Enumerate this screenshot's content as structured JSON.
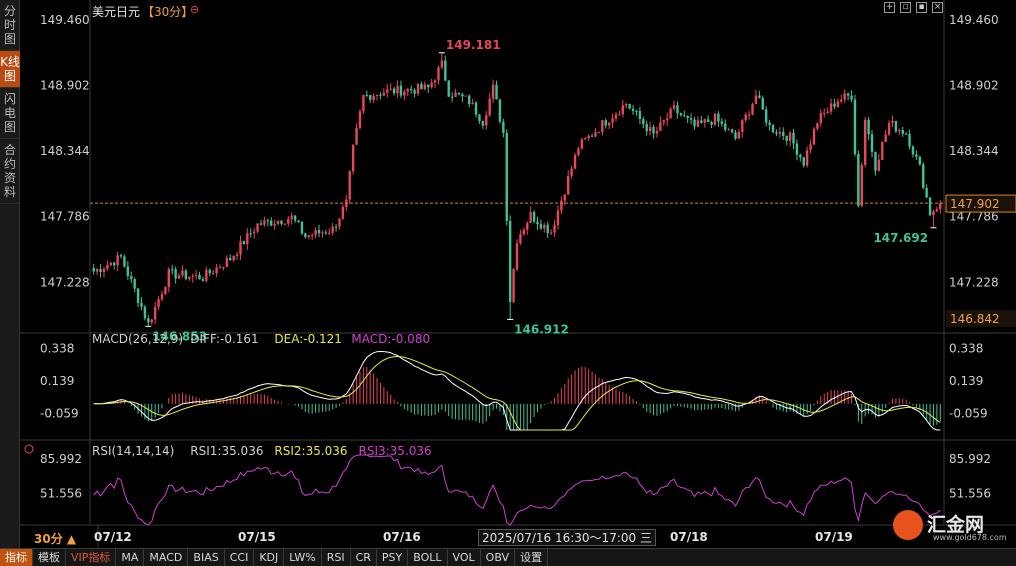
{
  "left_tabs": [
    {
      "label": "分时图",
      "active": false
    },
    {
      "label": "K线图",
      "active": true
    },
    {
      "label": "闪电图",
      "active": false
    },
    {
      "label": "合约资料",
      "active": false
    }
  ],
  "header": {
    "symbol": "美元日元",
    "period": "【30分】",
    "toolbar_icons": [
      "crosshair-icon",
      "zoom-in-icon",
      "restore-icon",
      "close-icon"
    ]
  },
  "price_axis": {
    "ticks": [
      "149.460",
      "148.902",
      "148.344",
      "147.786",
      "147.228"
    ],
    "current": "147.902",
    "bottom": "146.842"
  },
  "annotations": {
    "high": "149.181",
    "low_left": "146.853",
    "low_mid": "146.912",
    "low_right": "147.692"
  },
  "macd": {
    "label": "MACD(26,12,9)",
    "diff": "DIFF:-0.161",
    "dea": "DEA:-0.121",
    "macd": "MACD:-0.080",
    "ticks": [
      "0.338",
      "0.139",
      "-0.059"
    ]
  },
  "rsi": {
    "label": "RSI(14,14,14)",
    "rsi1": "RSI1:35.036",
    "rsi2": "RSI2:35.036",
    "rsi3": "RSI3:35.036",
    "ticks": [
      "85.992",
      "51.556"
    ]
  },
  "time_axis": {
    "period_label": "30分 ▲",
    "dates": [
      "07/12",
      "07/15",
      "07/16",
      "07/18",
      "07/19"
    ],
    "cursor_time": "2025/07/16 16:30～17:00 三"
  },
  "bottom_tabs": [
    "指标",
    "模板",
    "VIP指标",
    "MA",
    "MACD",
    "BIAS",
    "CCI",
    "KDJ",
    "LW%",
    "RSI",
    "CR",
    "PSY",
    "BOLL",
    "VOL",
    "OBV",
    "设置"
  ],
  "watermark": {
    "name": "汇金网",
    "url": "www.gold678.com"
  },
  "colors": {
    "up": "#e8465a",
    "down": "#3ec29a",
    "diff": "#ffffff",
    "dea": "#e8e84a",
    "rsi": "#d040d0",
    "accent": "#f0a040"
  },
  "chart_data": {
    "type": "candlestick",
    "title": "美元日元 30分",
    "ylim": [
      146.842,
      149.46
    ],
    "last_price": 147.902,
    "high": 149.181,
    "lows": [
      146.853,
      146.912,
      147.692
    ],
    "dates": [
      "07/12",
      "07/15",
      "07/16",
      "07/18",
      "07/19"
    ],
    "anchors": [
      {
        "i": 0,
        "p": 147.32
      },
      {
        "i": 8,
        "p": 147.44
      },
      {
        "i": 14,
        "p": 147.02
      },
      {
        "i": 16,
        "p": 146.87
      },
      {
        "i": 22,
        "p": 147.3
      },
      {
        "i": 32,
        "p": 147.27
      },
      {
        "i": 40,
        "p": 147.43
      },
      {
        "i": 48,
        "p": 147.72
      },
      {
        "i": 58,
        "p": 147.78
      },
      {
        "i": 62,
        "p": 147.62
      },
      {
        "i": 70,
        "p": 147.68
      },
      {
        "i": 74,
        "p": 147.9
      },
      {
        "i": 76,
        "p": 148.36
      },
      {
        "i": 79,
        "p": 148.81
      },
      {
        "i": 85,
        "p": 148.85
      },
      {
        "i": 98,
        "p": 148.88
      },
      {
        "i": 102,
        "p": 149.08
      },
      {
        "i": 104,
        "p": 148.85
      },
      {
        "i": 110,
        "p": 148.77
      },
      {
        "i": 114,
        "p": 148.6
      },
      {
        "i": 117,
        "p": 148.88
      },
      {
        "i": 120,
        "p": 148.5
      },
      {
        "i": 122,
        "p": 147.08
      },
      {
        "i": 124,
        "p": 147.6
      },
      {
        "i": 128,
        "p": 147.8
      },
      {
        "i": 134,
        "p": 147.66
      },
      {
        "i": 138,
        "p": 148.02
      },
      {
        "i": 142,
        "p": 148.38
      },
      {
        "i": 150,
        "p": 148.6
      },
      {
        "i": 156,
        "p": 148.75
      },
      {
        "i": 164,
        "p": 148.48
      },
      {
        "i": 170,
        "p": 148.7
      },
      {
        "i": 176,
        "p": 148.55
      },
      {
        "i": 182,
        "p": 148.62
      },
      {
        "i": 188,
        "p": 148.45
      },
      {
        "i": 194,
        "p": 148.82
      },
      {
        "i": 198,
        "p": 148.55
      },
      {
        "i": 204,
        "p": 148.46
      },
      {
        "i": 208,
        "p": 148.25
      },
      {
        "i": 212,
        "p": 148.6
      },
      {
        "i": 218,
        "p": 148.78
      },
      {
        "i": 222,
        "p": 148.82
      },
      {
        "i": 224,
        "p": 147.88
      },
      {
        "i": 226,
        "p": 148.62
      },
      {
        "i": 229,
        "p": 148.22
      },
      {
        "i": 233,
        "p": 148.58
      },
      {
        "i": 238,
        "p": 148.5
      },
      {
        "i": 242,
        "p": 148.2
      },
      {
        "i": 245,
        "p": 147.82
      },
      {
        "i": 248,
        "p": 147.9
      }
    ],
    "macd_series": {
      "names": [
        "DIFF",
        "DEA",
        "MACD"
      ],
      "last": {
        "DIFF": -0.161,
        "DEA": -0.121,
        "MACD": -0.08
      },
      "ylim": [
        -0.16,
        0.36
      ]
    },
    "rsi_series": {
      "names": [
        "RSI1",
        "RSI2",
        "RSI3"
      ],
      "last": {
        "RSI1": 35.036,
        "RSI2": 35.036,
        "RSI3": 35.036
      }
    }
  }
}
